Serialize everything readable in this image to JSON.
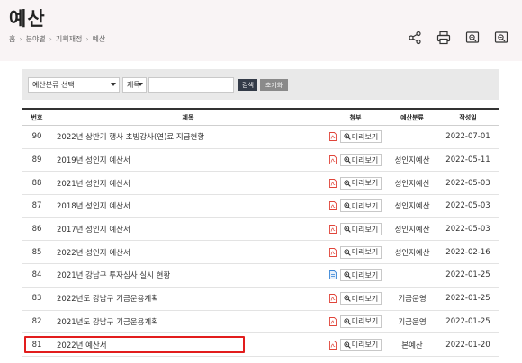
{
  "page": {
    "title": "예산"
  },
  "breadcrumb": [
    "홈",
    "분야별",
    "기획재정",
    "예산"
  ],
  "tools": [
    "share-icon",
    "print-icon",
    "zoom-in-icon",
    "zoom-out-icon"
  ],
  "search": {
    "category_selected": "예산분류 선택",
    "field_selected": "제목",
    "query_value": "",
    "search_label": "검색",
    "reset_label": "초기화"
  },
  "table": {
    "headers": {
      "no": "번호",
      "title": "제목",
      "file": "첨부",
      "category": "예산분류",
      "date": "작성일"
    },
    "preview_label": "미리보기",
    "rows": [
      {
        "no": "90",
        "title": "2022년 상반기 행사 초빙강사(연)료 지급현황",
        "file": "pdf",
        "category": "",
        "date": "2022-07-01"
      },
      {
        "no": "89",
        "title": "2019년 성인지 예산서",
        "file": "pdf",
        "category": "성인지예산",
        "date": "2022-05-11"
      },
      {
        "no": "88",
        "title": "2021년 성인지 예산서",
        "file": "pdf",
        "category": "성인지예산",
        "date": "2022-05-03"
      },
      {
        "no": "87",
        "title": "2018년 성인지 예산서",
        "file": "pdf",
        "category": "성인지예산",
        "date": "2022-05-03"
      },
      {
        "no": "86",
        "title": "2017년 성인지 예산서",
        "file": "pdf",
        "category": "성인지예산",
        "date": "2022-05-03"
      },
      {
        "no": "85",
        "title": "2022년 성인지 예산서",
        "file": "pdf",
        "category": "성인지예산",
        "date": "2022-02-16"
      },
      {
        "no": "84",
        "title": "2021년 강남구 투자심사 실시 현황",
        "file": "hwp",
        "category": "",
        "date": "2022-01-25"
      },
      {
        "no": "83",
        "title": "2022년도 강남구 기금운용계획",
        "file": "pdf",
        "category": "기금운영",
        "date": "2022-01-25"
      },
      {
        "no": "82",
        "title": "2021년도 강남구 기금운용계획",
        "file": "pdf",
        "category": "기금운영",
        "date": "2022-01-25"
      },
      {
        "no": "81",
        "title": "2022년 예산서",
        "file": "pdf",
        "category": "본예산",
        "date": "2022-01-20"
      }
    ]
  },
  "colors": {
    "header_bg": "#f9f4f5",
    "search_btn": "#333b48",
    "reset_btn": "#8a8a8a",
    "pdf_icon": "#e0453a",
    "hwp_icon": "#3b87d8",
    "highlight": "#e21d1d"
  }
}
